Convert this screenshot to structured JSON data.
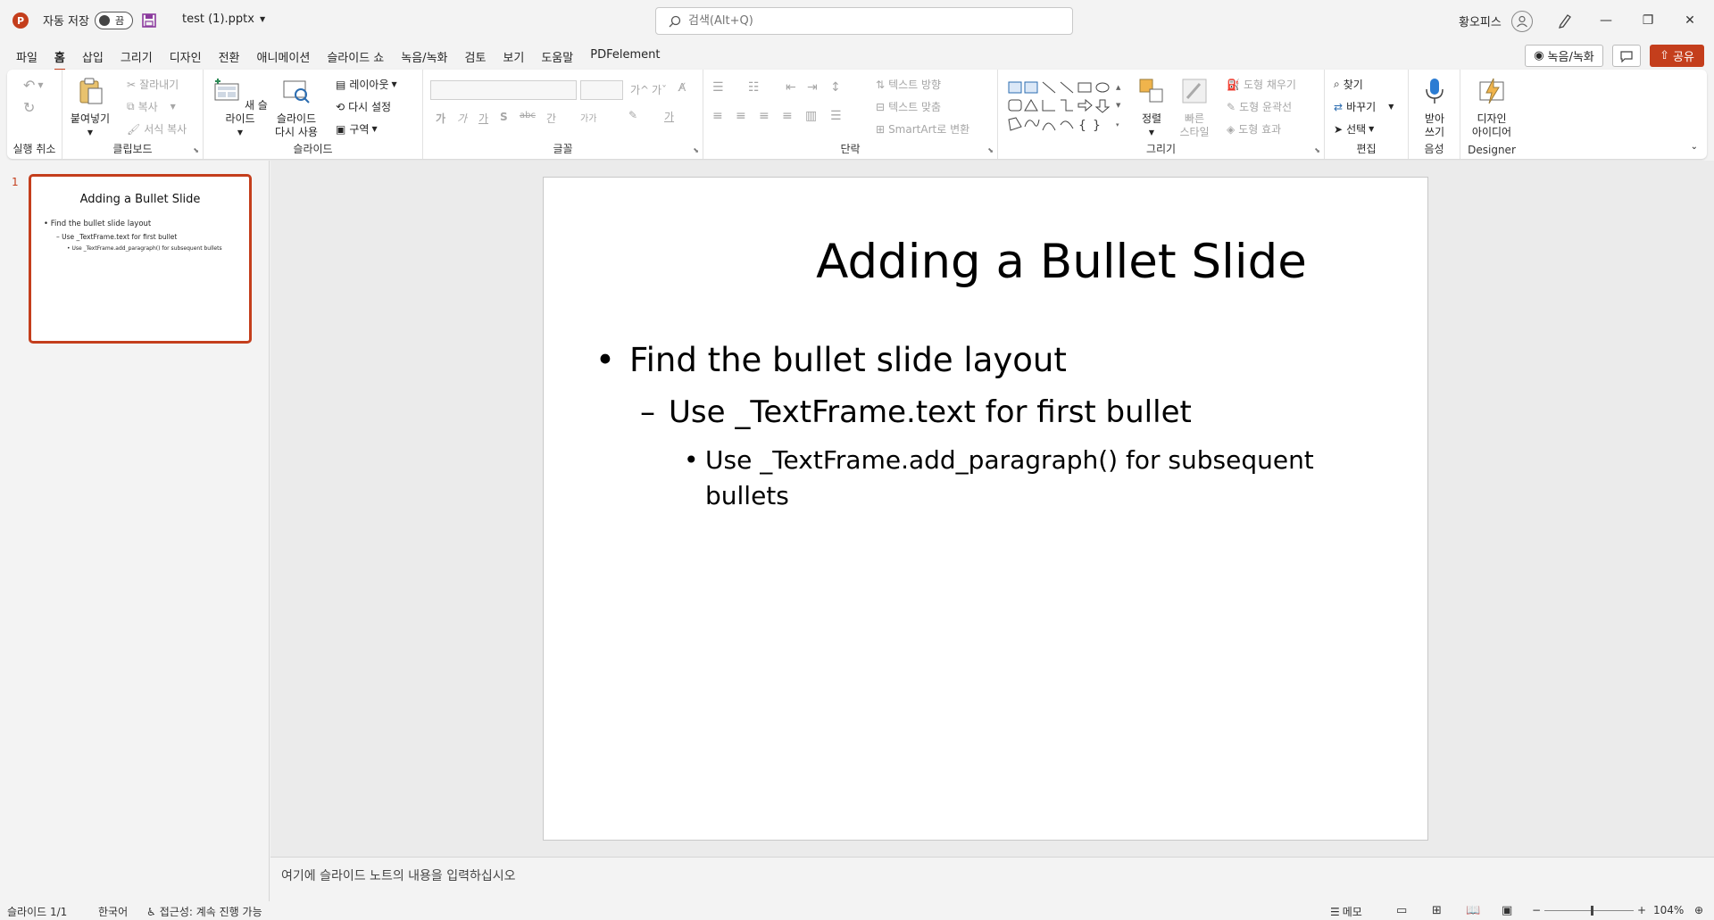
{
  "titlebar": {
    "app_logo": "P",
    "autosave_label": "자동 저장",
    "autosave_state": "끔",
    "filename": "test (1).pptx",
    "search_placeholder": "검색(Alt+Q)",
    "username": "황오피스"
  },
  "menu": {
    "tabs": [
      "파일",
      "홈",
      "삽입",
      "그리기",
      "디자인",
      "전환",
      "애니메이션",
      "슬라이드 쇼",
      "녹음/녹화",
      "검토",
      "보기",
      "도움말",
      "PDFelement"
    ],
    "active_tab": "홈",
    "record_label": "녹음/녹화",
    "share_label": "공유"
  },
  "ribbon": {
    "undo_group": "실행 취소",
    "clipboard": {
      "group": "클립보드",
      "paste": "붙여넣기",
      "cut": "잘라내기",
      "copy": "복사",
      "format_painter": "서식 복사"
    },
    "slides": {
      "group": "슬라이드",
      "new_slide": "새 슬라이드",
      "reuse_slide_1": "슬라이드",
      "reuse_slide_2": "다시 사용",
      "layout": "레이아웃",
      "reset": "다시 설정",
      "section": "구역"
    },
    "font": {
      "group": "글꼴",
      "grow": "가^",
      "shrink": "가ˇ",
      "bold": "가",
      "italic": "가",
      "underline": "가",
      "shadow": "S",
      "strike": "abc",
      "spacing": "간",
      "case": "가가",
      "color": "가"
    },
    "paragraph": {
      "group": "단락",
      "text_direction": "텍스트 방향",
      "align_text": "텍스트 맞춤",
      "smartart": "SmartArt로 변환"
    },
    "drawing": {
      "group": "그리기",
      "arrange": "정렬",
      "quick_styles_1": "빠른",
      "quick_styles_2": "스타일",
      "fill": "도형 채우기",
      "outline": "도형 윤곽선",
      "effects": "도형 효과"
    },
    "editing": {
      "group": "편집",
      "find": "찾기",
      "replace": "바꾸기",
      "select": "선택"
    },
    "voice": {
      "group": "음성",
      "dictate_1": "받아",
      "dictate_2": "쓰기"
    },
    "designer": {
      "group": "Designer",
      "ideas_1": "디자인",
      "ideas_2": "아이디어"
    }
  },
  "thumbnails": [
    {
      "number": "1",
      "title": "Adding a Bullet Slide",
      "b1": "Find the bullet slide layout",
      "b2": "Use _TextFrame.text for first bullet",
      "b3": "Use _TextFrame.add_paragraph() for subsequent bullets"
    }
  ],
  "slide": {
    "title": "Adding a Bullet Slide",
    "bullet1": "Find the bullet slide layout",
    "bullet2": "Use _TextFrame.text for first bullet",
    "bullet3": "Use _TextFrame.add_paragraph() for subsequent bullets",
    "bullet1_mark": "•",
    "bullet2_mark": "–",
    "bullet3_mark": "•"
  },
  "notes_placeholder": "여기에 슬라이드 노트의 내용을 입력하십시오",
  "status": {
    "slide_count": "슬라이드 1/1",
    "language": "한국어",
    "accessibility": "접근성: 계속 진행 가능",
    "notes": "메모",
    "zoom": "104%",
    "zoom_fraction": 0.52
  },
  "colors": {
    "accent": "#c43e1c",
    "disabled": "#a6a6a6"
  }
}
